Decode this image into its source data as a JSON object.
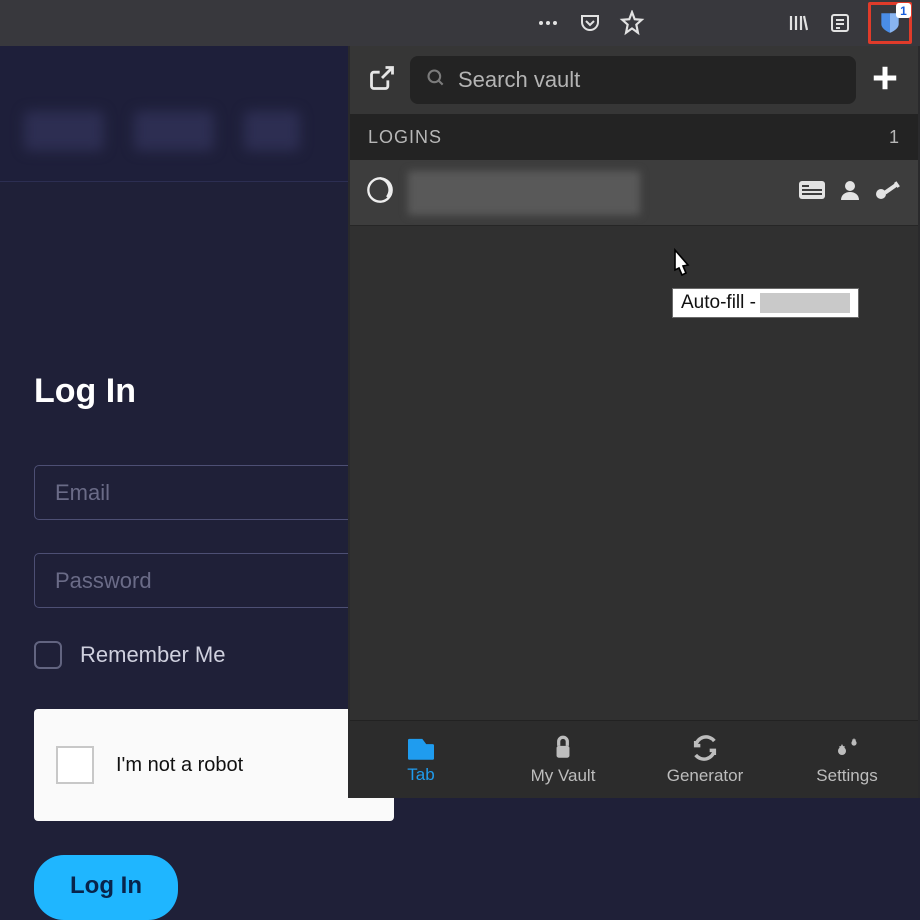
{
  "browser": {
    "bitwarden_badge": "1"
  },
  "page": {
    "title": "Log In",
    "email_placeholder": "Email",
    "password_placeholder": "Password",
    "remember_label": "Remember Me",
    "captcha_label": "I'm not a robot",
    "login_button": "Log In"
  },
  "popup": {
    "search_placeholder": "Search vault",
    "section_title": "LOGINS",
    "section_count": "1",
    "tooltip_prefix": "Auto-fill - ",
    "tabs": {
      "tab": "Tab",
      "vault": "My Vault",
      "generator": "Generator",
      "settings": "Settings"
    }
  }
}
